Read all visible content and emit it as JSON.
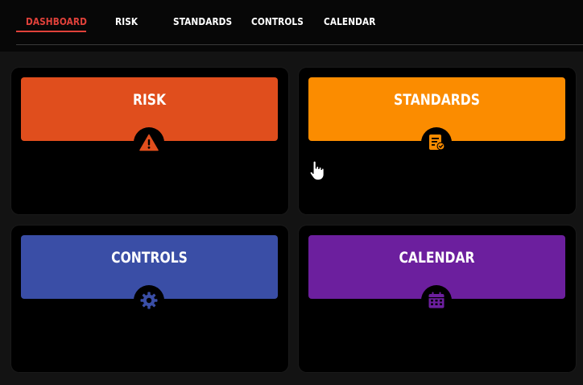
{
  "nav": {
    "tabs": [
      {
        "label": "DASHBOARD",
        "active": true
      },
      {
        "label": "RISK",
        "active": false
      },
      {
        "label": "STANDARDS",
        "active": false
      },
      {
        "label": "CONTROLS",
        "active": false
      },
      {
        "label": "CALENDAR",
        "active": false
      }
    ],
    "active_color": "#e0413a"
  },
  "cards": [
    {
      "title": "RISK",
      "color": "#e04e1d",
      "icon": "warning-icon"
    },
    {
      "title": "STANDARDS",
      "color": "#fb8c00",
      "icon": "document-check-icon"
    },
    {
      "title": "CONTROLS",
      "color": "#3a4ea6",
      "icon": "gear-icon"
    },
    {
      "title": "CALENDAR",
      "color": "#6c1f9e",
      "icon": "calendar-icon"
    }
  ]
}
